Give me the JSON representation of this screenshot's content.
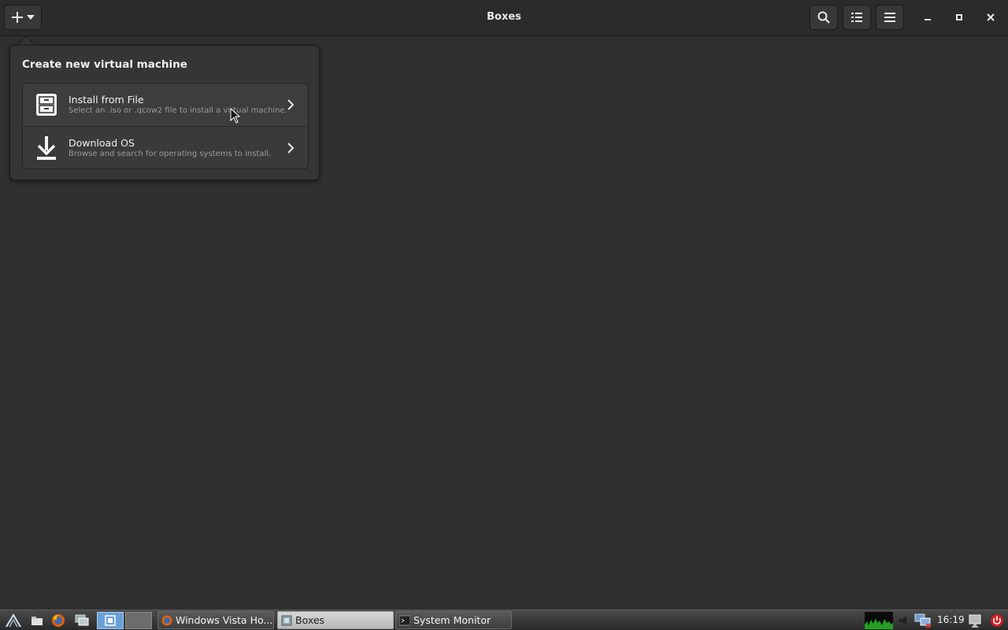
{
  "window": {
    "title": "Boxes"
  },
  "headerbar": {
    "new_button_icon": "plus-icon",
    "buttons": [
      "search-icon",
      "list-view-icon",
      "menu-icon"
    ],
    "window_controls": [
      "minimize-icon",
      "maximize-icon",
      "close-icon"
    ]
  },
  "popover": {
    "title": "Create new virtual machine",
    "options": [
      {
        "icon": "file-cabinet-icon",
        "title": "Install from File",
        "subtitle": "Select an .iso or .qcow2 file to install a virtual machine."
      },
      {
        "icon": "download-icon",
        "title": "Download OS",
        "subtitle": "Browse and search for operating systems to install."
      }
    ]
  },
  "taskbar": {
    "launchers": [
      "start-menu-icon",
      "file-manager-icon",
      "firefox-icon",
      "windows-switch-icon",
      "desktop-1-icon",
      "desktop-2-icon"
    ],
    "tasks": [
      {
        "label": "Windows Vista Ho...",
        "icon": "firefox-icon",
        "active": false
      },
      {
        "label": "Boxes",
        "icon": "boxes-icon",
        "active": true
      },
      {
        "label": "System Monitor",
        "icon": "terminal-icon",
        "active": false
      }
    ],
    "clock": "16:19"
  },
  "colors": {
    "background": "#303030",
    "headerbar": "#2b2b2b",
    "popover": "#353535",
    "text": "#eeeeec",
    "subtext": "#9a9a9a"
  }
}
